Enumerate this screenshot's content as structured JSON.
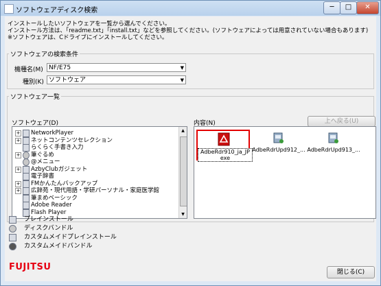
{
  "window": {
    "title": "ソフトウェアディスク検索",
    "controls": {
      "minimize": "─",
      "maximize": "□",
      "close": "✕"
    }
  },
  "intro": {
    "line1": "インストールしたいソフトウェアを一覧から選んでください。",
    "line2": "インストール方法は、「readme.txt」「install.txt」などを参照してください。(ソフトウェアによっては用意されていない場合もあります)",
    "line3": "※ソフトウェアは、Cドライブにインストールしてください。"
  },
  "search": {
    "legend": "ソフトウェアの検索条件",
    "model_label": "機種名(M)",
    "model_value": "NF/E75",
    "type_label": "種別(K)",
    "type_value": "ソフトウェア"
  },
  "list": {
    "legend": "ソフトウェア一覧",
    "software_label": "ソフトウェア(D)",
    "content_label": "内容(N)",
    "back_button": "上へ戻る(U)",
    "tree_items": [
      {
        "label": "NetworkPlayer",
        "expander": "+",
        "icon": "package-icon"
      },
      {
        "label": "ネットコンテンツセレクション",
        "expander": "+",
        "icon": "package-icon"
      },
      {
        "label": "らくらく手書き入力",
        "expander": "",
        "icon": "package-icon"
      },
      {
        "label": "筆ぐるめ",
        "expander": "+",
        "icon": "disc-icon"
      },
      {
        "label": "@メニュー",
        "expander": "",
        "icon": "disc-icon"
      },
      {
        "label": "AzbyClubガジェット",
        "expander": "+",
        "icon": "package-icon"
      },
      {
        "label": "電子辞書",
        "expander": "",
        "icon": "package-icon"
      },
      {
        "label": "FMかんたんバックアップ",
        "expander": "+",
        "icon": "package-icon"
      },
      {
        "label": "広辞苑・現代用語・学研パーソナル・家庭医学館",
        "expander": "+",
        "icon": "package-icon"
      },
      {
        "label": "筆まめベーシック",
        "expander": "",
        "icon": "package-icon"
      },
      {
        "label": "Adobe Reader",
        "expander": "",
        "icon": "package-icon"
      },
      {
        "label": "Flash Player",
        "expander": "",
        "icon": "package-icon"
      }
    ],
    "content_items": [
      {
        "caption": "AdbeRdr910_ja_JP",
        "caption2": "exe",
        "icon": "pdf-icon"
      },
      {
        "caption": "AdbeRdrUpd912_...",
        "caption2": "",
        "icon": "installer-icon"
      },
      {
        "caption": "AdbeRdrUpd913_...",
        "caption2": "",
        "icon": "installer-icon"
      }
    ]
  },
  "legend_items": [
    {
      "label": "プレインストール",
      "icon": "preinstall-icon"
    },
    {
      "label": "ディスクバンドル",
      "icon": "disc-bundle-icon"
    },
    {
      "label": "カスタムメイドプレインストール",
      "icon": "custom-preinstall-icon"
    },
    {
      "label": "カスタムメイドバンドル",
      "icon": "custom-bundle-icon"
    }
  ],
  "footer": {
    "logo": "FUJITSU",
    "close_button": "閉じる(C)"
  },
  "colors": {
    "selection_outline": "#e30000",
    "brand": "#e60012"
  }
}
